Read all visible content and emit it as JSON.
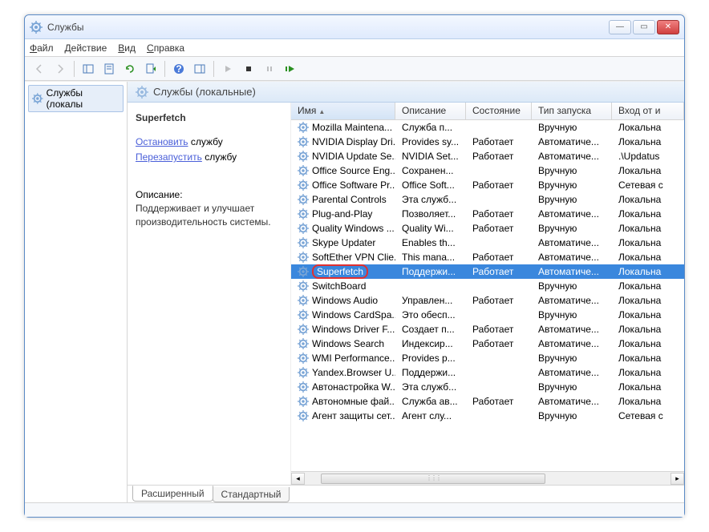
{
  "window": {
    "title": "Службы"
  },
  "menu": {
    "file": "Файл",
    "action": "Действие",
    "view": "Вид",
    "help": "Справка"
  },
  "tree": {
    "node": "Службы (локалы"
  },
  "header": {
    "title": "Службы (локальные)"
  },
  "detail": {
    "name": "Superfetch",
    "stop_link": "Остановить",
    "stop_suffix": " службу",
    "restart_link": "Перезапустить",
    "restart_suffix": " службу",
    "desc_label": "Описание:",
    "desc": "Поддерживает и улучшает производительность системы."
  },
  "columns": {
    "name": "Имя",
    "desc": "Описание",
    "state": "Состояние",
    "start": "Тип запуска",
    "logon": "Вход от и"
  },
  "services": [
    {
      "name": "Mozilla Maintena...",
      "desc": "Служба п...",
      "state": "",
      "start": "Вручную",
      "logon": "Локальна"
    },
    {
      "name": "NVIDIA Display Dri...",
      "desc": "Provides sy...",
      "state": "Работает",
      "start": "Автоматиче...",
      "logon": "Локальна"
    },
    {
      "name": "NVIDIA Update Se...",
      "desc": "NVIDIA Set...",
      "state": "Работает",
      "start": "Автоматиче...",
      "logon": ".\\Updatus"
    },
    {
      "name": "Office  Source Eng...",
      "desc": "Сохранен...",
      "state": "",
      "start": "Вручную",
      "logon": "Локальна"
    },
    {
      "name": "Office Software Pr...",
      "desc": "Office Soft...",
      "state": "Работает",
      "start": "Вручную",
      "logon": "Сетевая с"
    },
    {
      "name": "Parental Controls",
      "desc": "Эта служб...",
      "state": "",
      "start": "Вручную",
      "logon": "Локальна"
    },
    {
      "name": "Plug-and-Play",
      "desc": "Позволяет...",
      "state": "Работает",
      "start": "Автоматиче...",
      "logon": "Локальна"
    },
    {
      "name": "Quality Windows ...",
      "desc": "Quality Wi...",
      "state": "Работает",
      "start": "Вручную",
      "logon": "Локальна"
    },
    {
      "name": "Skype Updater",
      "desc": "Enables th...",
      "state": "",
      "start": "Автоматиче...",
      "logon": "Локальна"
    },
    {
      "name": "SoftEther VPN Clie...",
      "desc": "This mana...",
      "state": "Работает",
      "start": "Автоматиче...",
      "logon": "Локальна"
    },
    {
      "name": "Superfetch",
      "desc": "Поддержи...",
      "state": "Работает",
      "start": "Автоматиче...",
      "logon": "Локальна",
      "selected": true
    },
    {
      "name": "SwitchBoard",
      "desc": "",
      "state": "",
      "start": "Вручную",
      "logon": "Локальна"
    },
    {
      "name": "Windows Audio",
      "desc": "Управлен...",
      "state": "Работает",
      "start": "Автоматиче...",
      "logon": "Локальна"
    },
    {
      "name": "Windows CardSpa...",
      "desc": "Это обесп...",
      "state": "",
      "start": "Вручную",
      "logon": "Локальна"
    },
    {
      "name": "Windows Driver F...",
      "desc": "Создает п...",
      "state": "Работает",
      "start": "Автоматиче...",
      "logon": "Локальна"
    },
    {
      "name": "Windows Search",
      "desc": "Индексир...",
      "state": "Работает",
      "start": "Автоматиче...",
      "logon": "Локальна"
    },
    {
      "name": "WMI Performance...",
      "desc": "Provides p...",
      "state": "",
      "start": "Вручную",
      "logon": "Локальна"
    },
    {
      "name": "Yandex.Browser U...",
      "desc": "Поддержи...",
      "state": "",
      "start": "Автоматиче...",
      "logon": "Локальна"
    },
    {
      "name": "Автонастройка W...",
      "desc": "Эта служб...",
      "state": "",
      "start": "Вручную",
      "logon": "Локальна"
    },
    {
      "name": "Автономные фай...",
      "desc": "Служба ав...",
      "state": "Работает",
      "start": "Автоматиче...",
      "logon": "Локальна"
    },
    {
      "name": "Агент защиты сет...",
      "desc": "Агент слу...",
      "state": "",
      "start": "Вручную",
      "logon": "Сетевая с"
    }
  ],
  "tabs": {
    "extended": "Расширенный",
    "standard": "Стандартный"
  }
}
